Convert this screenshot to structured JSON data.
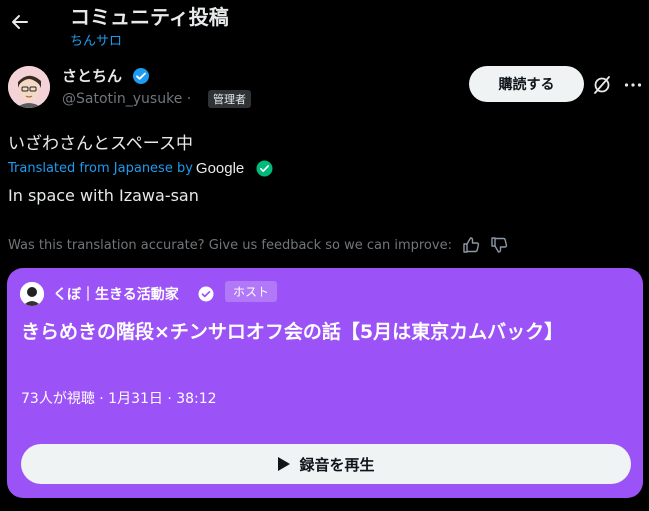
{
  "header": {
    "title": "コミュニティ投稿",
    "community_name": "ちんサロ"
  },
  "author": {
    "display_name": "さとちん",
    "handle": "@Satotin_yusuke ·",
    "role_badge": "管理者"
  },
  "actions": {
    "subscribe_label": "購読する"
  },
  "post": {
    "text": "いざわさんとスペース中",
    "translated_label": "Translated from Japanese by",
    "translator": "Google",
    "translated_text": "In space with Izawa-san",
    "feedback_prompt": "Was this translation accurate? Give us feedback so we can improve:"
  },
  "space": {
    "host_name": "くぼ｜生きる活動家",
    "host_badge": "ホスト",
    "title": "きらめきの階段×チンサロオフ会の話【5月は東京カムバック】",
    "meta": "73人が視聴 · 1月31日 · 38:12",
    "play_label": "録音を再生"
  },
  "colors": {
    "accent": "#1d9bf0",
    "space_card": "#9b52f7",
    "verified": "#1d9bf0",
    "translation_check": "#00ba7c"
  }
}
